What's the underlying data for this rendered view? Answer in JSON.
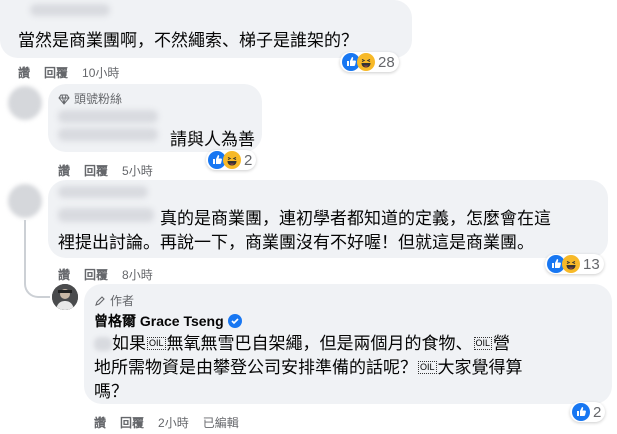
{
  "comment1": {
    "text": "當然是商業團啊，不然繩索、梯子是誰架的？",
    "actions": {
      "like": "讚",
      "reply": "回覆",
      "time": "10小時"
    },
    "reaction_count": "28"
  },
  "comment2": {
    "badge": "頭號粉絲",
    "text": "請與人為善",
    "actions": {
      "like": "讚",
      "reply": "回覆",
      "time": "5小時"
    },
    "reaction_count": "2"
  },
  "comment3": {
    "line1": "真的是商業團，連初學者都知道的定義，怎麼會在這",
    "line2": "裡提出討論。再說一下，商業團沒有不好喔！但就這是商業團。",
    "actions": {
      "like": "讚",
      "reply": "回覆",
      "time": "8小時"
    },
    "reaction_count": "13"
  },
  "reply": {
    "badge": "作者",
    "author": "曾格爾 Grace Tseng",
    "line1_a": "如果",
    "line1_b": "無氧無雪巴自架繩，但是兩個月的食物、",
    "line1_c": "營",
    "line2_a": "地所需物資是由攀登公司安排準備的話呢？",
    "line2_b": "大家覺得算",
    "line3": "嗎？",
    "emoji_box": "OIL",
    "actions": {
      "like": "讚",
      "reply": "回覆",
      "time": "2小時",
      "edited": "已編輯"
    },
    "reaction_count": "2"
  },
  "colors": {
    "bubble": "#f0f2f5",
    "meta": "#65676b",
    "like_blue": "#1877f2",
    "haha_yellow": "#f7b928"
  },
  "icons": [
    "like-icon",
    "haha-icon",
    "diamond-icon",
    "pen-icon",
    "verified-icon"
  ]
}
